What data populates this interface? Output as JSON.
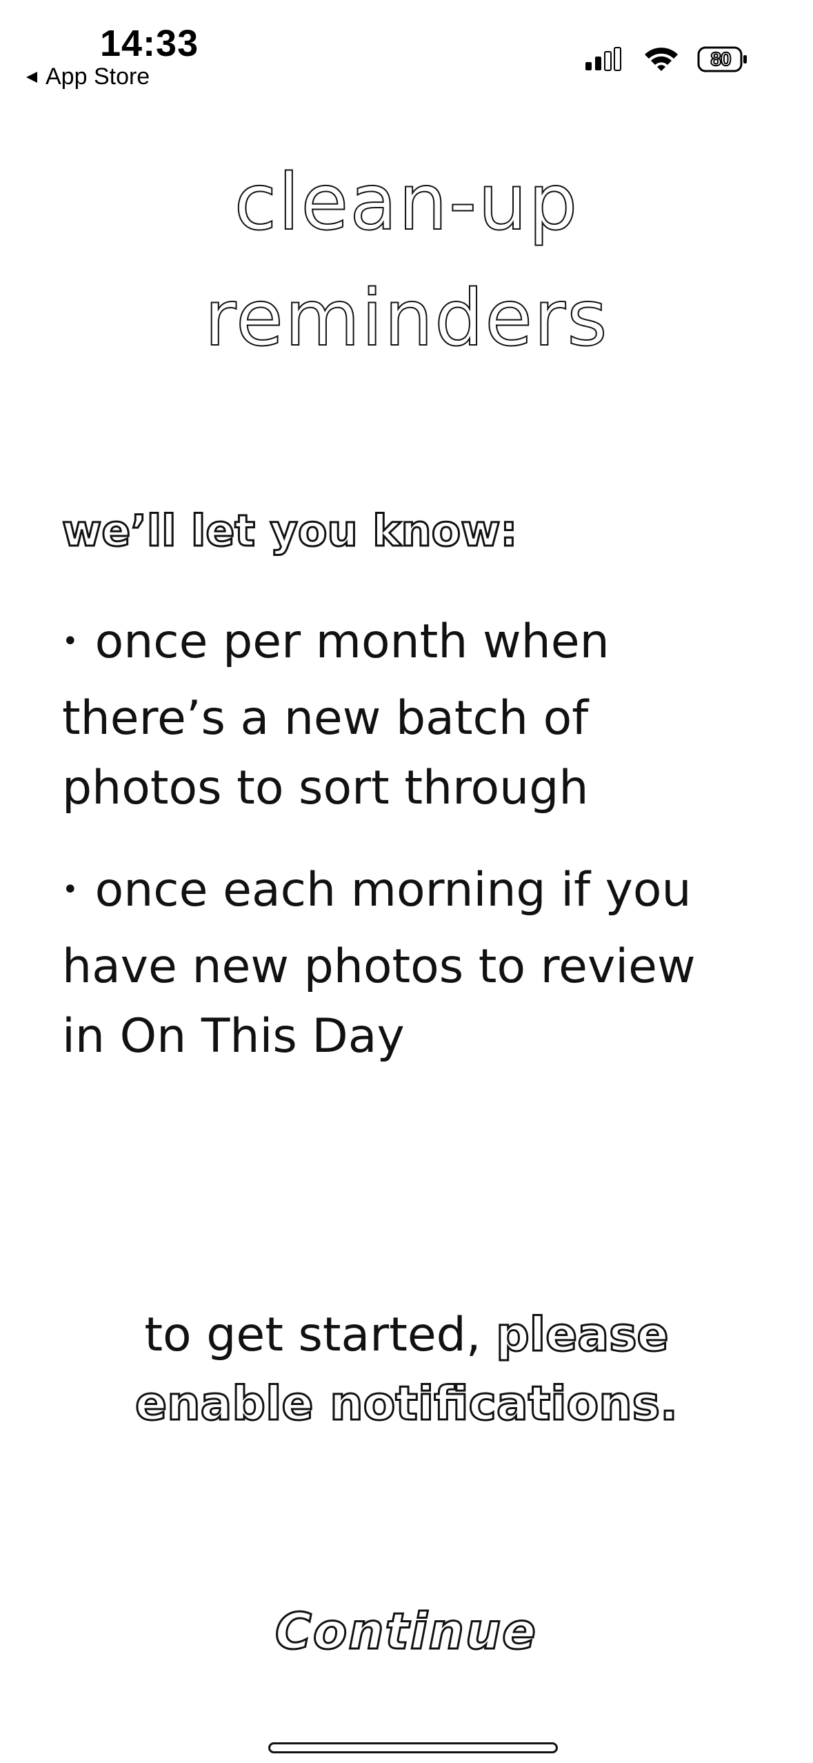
{
  "status_bar": {
    "time": "14:33",
    "back_label": "App Store",
    "back_icon": "back-triangle-icon",
    "signal_icon": "cellular-signal-icon",
    "wifi_icon": "wifi-icon",
    "battery_percent": "80",
    "battery_icon": "battery-charging-icon"
  },
  "title": {
    "line1": "clean-up",
    "line2": "reminders"
  },
  "intro": "we’ll let you know:",
  "bullets": [
    {
      "marker": "•",
      "line1": "once per month when",
      "line2": "there’s a new batch of",
      "line3": "photos to sort through"
    },
    {
      "marker": "•",
      "line1": "once each morning if you",
      "line2": "have new photos to review",
      "line3": "in On This Day"
    }
  ],
  "cta": {
    "plain": "to get started,",
    "emphasis_line1": "please",
    "emphasis_line2": "enable notifications."
  },
  "continue_label": "Continue",
  "colors": {
    "background": "#ffffff",
    "text": "#111111",
    "outline_fill": "#ffffff"
  }
}
